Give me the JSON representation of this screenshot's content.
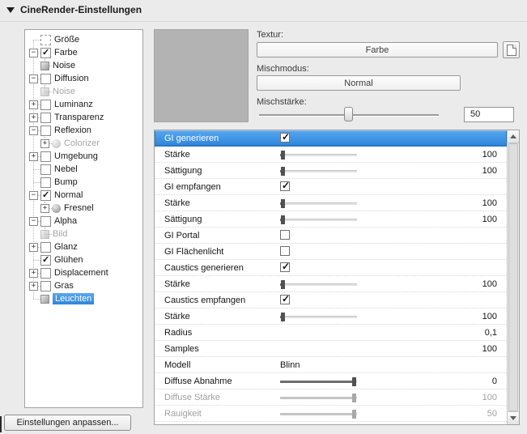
{
  "header": {
    "title": "CineRender-Einstellungen"
  },
  "colors": {
    "selection_top": "#58a7ef",
    "selection_bottom": "#2d86dc",
    "selection_border": "#2a77c2",
    "preview_gray": "#b3b3b3"
  },
  "tree": {
    "settings_button": "Einstellungen anpassen...",
    "items": [
      {
        "label": "Größe",
        "level": 0,
        "checkbox": "dashed"
      },
      {
        "label": "Farbe",
        "level": 0,
        "checkbox": "checked",
        "expander": "minus"
      },
      {
        "label": "Noise",
        "level": 1,
        "icon": "texture"
      },
      {
        "label": "Diffusion",
        "level": 0,
        "checkbox": "unchecked",
        "expander": "minus"
      },
      {
        "label": "Noise",
        "level": 1,
        "icon": "texture",
        "disabled": true
      },
      {
        "label": "Luminanz",
        "level": 0,
        "checkbox": "unchecked",
        "expander": "plus"
      },
      {
        "label": "Transparenz",
        "level": 0,
        "checkbox": "unchecked",
        "expander": "plus"
      },
      {
        "label": "Reflexion",
        "level": 0,
        "checkbox": "unchecked",
        "expander": "minus"
      },
      {
        "label": "Colorizer",
        "level": 1,
        "icon": "sphere",
        "expander": "plus",
        "disabled": true
      },
      {
        "label": "Umgebung",
        "level": 0,
        "checkbox": "unchecked",
        "expander": "plus"
      },
      {
        "label": "Nebel",
        "level": 0,
        "checkbox": "unchecked"
      },
      {
        "label": "Bump",
        "level": 0,
        "checkbox": "unchecked"
      },
      {
        "label": "Normal",
        "level": 0,
        "checkbox": "checked",
        "expander": "minus"
      },
      {
        "label": "Fresnel",
        "level": 1,
        "icon": "sphere",
        "expander": "plus"
      },
      {
        "label": "Alpha",
        "level": 0,
        "checkbox": "unchecked",
        "expander": "minus"
      },
      {
        "label": "Bild",
        "level": 1,
        "icon": "texture",
        "disabled": true
      },
      {
        "label": "Glanz",
        "level": 0,
        "checkbox": "unchecked",
        "expander": "plus"
      },
      {
        "label": "Glühen",
        "level": 0,
        "checkbox": "checked"
      },
      {
        "label": "Displacement",
        "level": 0,
        "checkbox": "unchecked",
        "expander": "plus"
      },
      {
        "label": "Gras",
        "level": 0,
        "checkbox": "unchecked",
        "expander": "plus"
      },
      {
        "label": "Leuchten",
        "level": 0,
        "icon": "texture",
        "selected": true
      }
    ]
  },
  "texture_panel": {
    "texture_label": "Textur:",
    "texture_value": "Farbe",
    "mix_mode_label": "Mischmodus:",
    "mix_mode_value": "Normal",
    "mix_strength_label": "Mischstärke:",
    "mix_strength_value": "50",
    "mix_strength_percent": 50
  },
  "properties": [
    {
      "label": "GI generieren",
      "control": "checkbox",
      "checked": true,
      "selected": true
    },
    {
      "label": "Stärke",
      "control": "slider",
      "value": "100",
      "thumb": 3,
      "fill": 3
    },
    {
      "label": "Sättigung",
      "control": "slider",
      "value": "100",
      "thumb": 3,
      "fill": 3
    },
    {
      "label": "GI empfangen",
      "control": "checkbox",
      "checked": true
    },
    {
      "label": "Stärke",
      "control": "slider",
      "value": "100",
      "thumb": 3,
      "fill": 3
    },
    {
      "label": "Sättigung",
      "control": "slider",
      "value": "100",
      "thumb": 3,
      "fill": 3
    },
    {
      "label": "GI Portal",
      "control": "checkbox",
      "checked": false
    },
    {
      "label": "GI Flächenlicht",
      "control": "checkbox",
      "checked": false
    },
    {
      "label": "Caustics generieren",
      "control": "checkbox",
      "checked": true
    },
    {
      "label": "Stärke",
      "control": "slider",
      "value": "100",
      "thumb": 3,
      "fill": 3
    },
    {
      "label": "Caustics empfangen",
      "control": "checkbox",
      "checked": true
    },
    {
      "label": "Stärke",
      "control": "slider",
      "value": "100",
      "thumb": 3,
      "fill": 3
    },
    {
      "label": "Radius",
      "control": "none",
      "value": "0,1"
    },
    {
      "label": "Samples",
      "control": "none",
      "value": "100"
    },
    {
      "label": "Modell",
      "control": "text",
      "value": "Blinn"
    },
    {
      "label": "Diffuse Abnahme",
      "control": "slider",
      "value": "0",
      "thumb": 96,
      "fill": 96
    },
    {
      "label": "Diffuse Stärke",
      "control": "slider",
      "value": "100",
      "thumb": 96,
      "fill": 96,
      "disabled": true
    },
    {
      "label": "Rauigkeit",
      "control": "slider",
      "value": "50",
      "thumb": 96,
      "fill": 96,
      "disabled": true
    }
  ]
}
